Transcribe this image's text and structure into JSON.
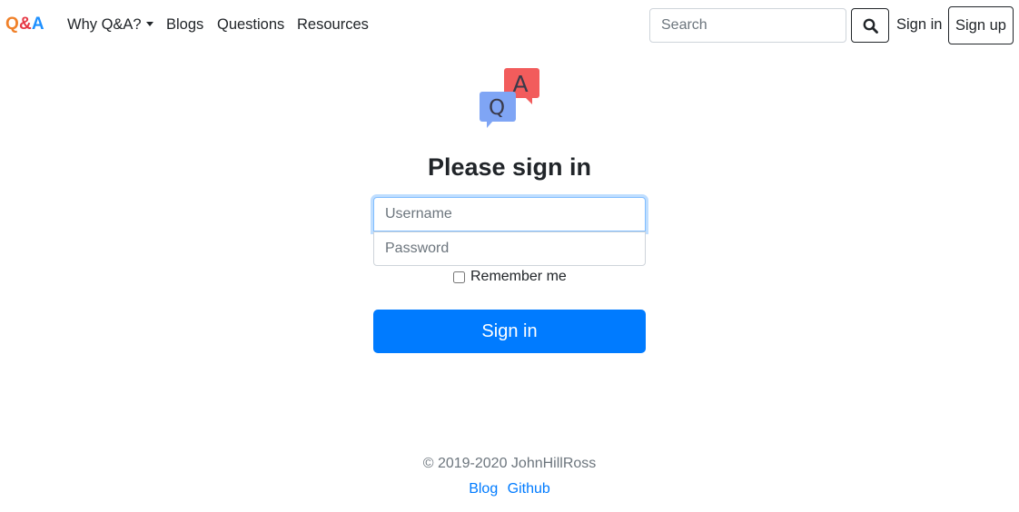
{
  "navbar": {
    "brand": {
      "q": "Q",
      "amp": "&",
      "a": "A"
    },
    "links": {
      "why": "Why Q&A?",
      "blogs": "Blogs",
      "questions": "Questions",
      "resources": "Resources"
    },
    "search": {
      "placeholder": "Search",
      "value": "",
      "icon": "search-icon"
    },
    "sign_in": "Sign in",
    "sign_up": "Sign up"
  },
  "form": {
    "logo_icon": "qa-chat-bubbles-icon",
    "logo_letters": {
      "question": "Q",
      "answer": "A"
    },
    "title": "Please sign in",
    "username": {
      "placeholder": "Username",
      "value": ""
    },
    "password": {
      "placeholder": "Password",
      "value": ""
    },
    "remember_label": "Remember me",
    "remember_checked": false,
    "submit_label": "Sign in"
  },
  "footer": {
    "copyright": "© 2019-2020 JohnHillRoss",
    "links": [
      "Blog",
      "Github"
    ]
  },
  "colors": {
    "primary": "#007bff",
    "brand_q": "#f0812a",
    "brand_amp": "#e63946",
    "brand_a": "#1e90ff",
    "logo_blue": "#7fa5f5",
    "logo_red": "#f25c5c"
  }
}
